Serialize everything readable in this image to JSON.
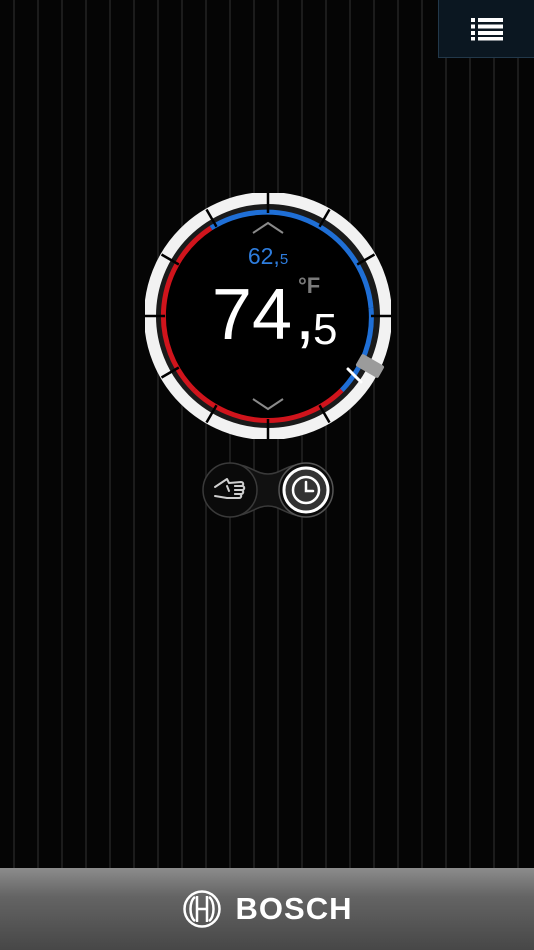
{
  "header": {
    "menu_icon": "list-icon"
  },
  "thermostat": {
    "setpoint_int": "62,",
    "setpoint_dec": "5",
    "current_int": "74",
    "current_comma": ",",
    "current_dec": "5",
    "unit": "°F",
    "up_icon": "chevron-up-icon",
    "down_icon": "chevron-down-icon",
    "colors": {
      "heat": "#d0141c",
      "cool": "#1f6fd6",
      "setpoint": "#2e7dde"
    }
  },
  "modes": {
    "manual_icon": "hand-icon",
    "schedule_icon": "clock-icon",
    "active": "schedule"
  },
  "footer": {
    "brand": "BOSCH",
    "logo_icon": "bosch-logo-icon"
  }
}
